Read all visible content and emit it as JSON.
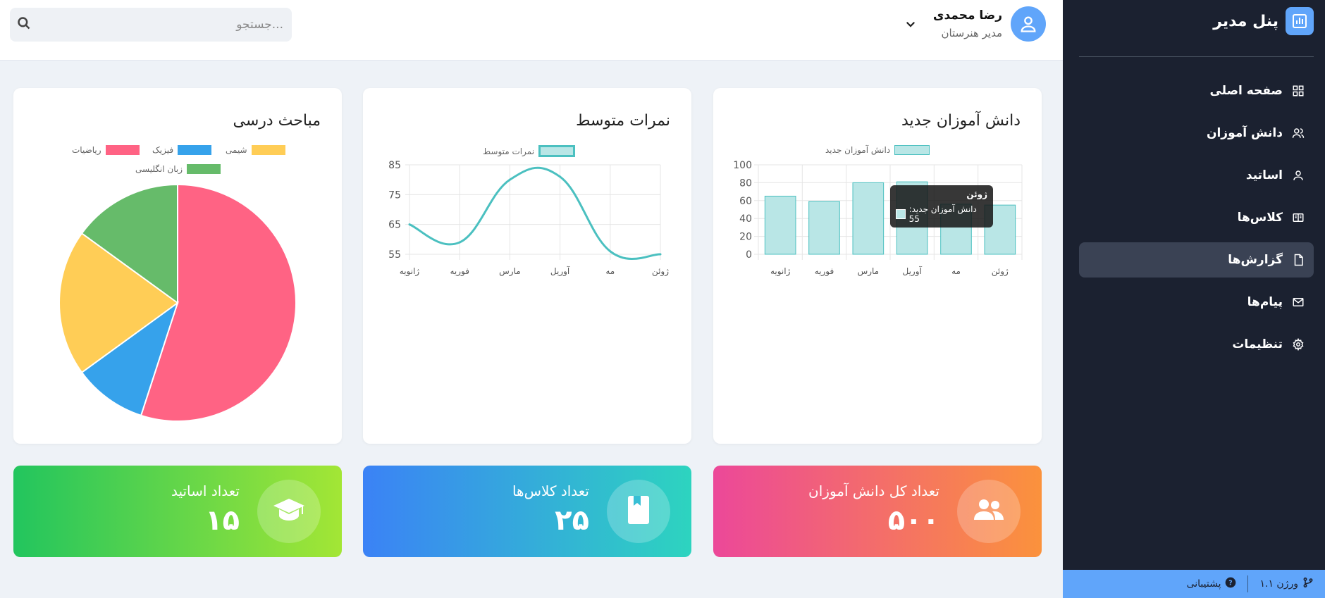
{
  "sidebar": {
    "brand_title": "پنل مدیر",
    "items": [
      {
        "label": "صفحه اصلی",
        "icon": "grid-icon",
        "active": false
      },
      {
        "label": "دانش آموزان",
        "icon": "users-icon",
        "active": false
      },
      {
        "label": "اساتید",
        "icon": "user-icon",
        "active": false
      },
      {
        "label": "کلاس‌ها",
        "icon": "book-open-icon",
        "active": false
      },
      {
        "label": "گزارش‌ها",
        "icon": "file-icon",
        "active": true
      },
      {
        "label": "پیام‌ها",
        "icon": "mail-icon",
        "active": false
      },
      {
        "label": "تنظیمات",
        "icon": "gear-icon",
        "active": false
      }
    ],
    "footer": {
      "version": "ورژن ۱.۱",
      "support": "پشتیبانی"
    }
  },
  "header": {
    "search_placeholder": "جستجو...",
    "user_name": "رضا محمدی",
    "user_role": "مدیر هنرستان"
  },
  "cards": {
    "students_title": "دانش آموزان جدید",
    "grades_title": "نمرات متوسط",
    "subjects_title": "مباحث درسی"
  },
  "tooltip": {
    "title": "ژوئن",
    "label": "دانش آموزان جدید: 55"
  },
  "chart_data": [
    {
      "type": "bar",
      "title": "دانش آموزان جدید",
      "categories": [
        "ژانویه",
        "فوریه",
        "مارس",
        "آوریل",
        "مه",
        "ژوئن"
      ],
      "series": [
        {
          "name": "دانش آموزان جدید",
          "values": [
            65,
            59,
            80,
            81,
            56,
            55
          ]
        }
      ],
      "ylim": [
        0,
        100
      ],
      "yticks": [
        0,
        20,
        40,
        60,
        80,
        100
      ],
      "grid": true,
      "legend": "top",
      "color_fill": "#b9e6e6",
      "color_stroke": "#4bc0c0"
    },
    {
      "type": "line",
      "title": "نمرات متوسط",
      "categories": [
        "ژانویه",
        "فوریه",
        "مارس",
        "آوریل",
        "مه",
        "ژوئن"
      ],
      "series": [
        {
          "name": "نمرات متوسط",
          "values": [
            65,
            59,
            80,
            81,
            56,
            55
          ]
        }
      ],
      "ylim": [
        55,
        85
      ],
      "yticks": [
        55,
        65,
        75,
        85
      ],
      "grid": true,
      "legend": "top",
      "color": "#4bc0c0"
    },
    {
      "type": "pie",
      "title": "مباحث درسی",
      "labels": [
        "ریاضیات",
        "فیزیک",
        "شیمی",
        "زبان انگلیسی"
      ],
      "values": [
        55,
        10,
        20,
        15
      ],
      "colors": [
        "#ff6384",
        "#36a2eb",
        "#ffcd56",
        "#66bb6a"
      ],
      "legend": "top"
    }
  ],
  "stats": [
    {
      "title": "تعداد کل دانش آموزان",
      "value": "۵۰۰",
      "icon": "users-icon",
      "gradient": [
        "#ec4899",
        "#fb923c"
      ]
    },
    {
      "title": "تعداد کلاس‌ها",
      "value": "۲۵",
      "icon": "book-icon",
      "gradient": [
        "#3b82f6",
        "#2dd4bf"
      ]
    },
    {
      "title": "تعداد اساتید",
      "value": "۱۵",
      "icon": "graduation-cap-icon",
      "gradient": [
        "#22c55e",
        "#a3e635"
      ]
    }
  ]
}
